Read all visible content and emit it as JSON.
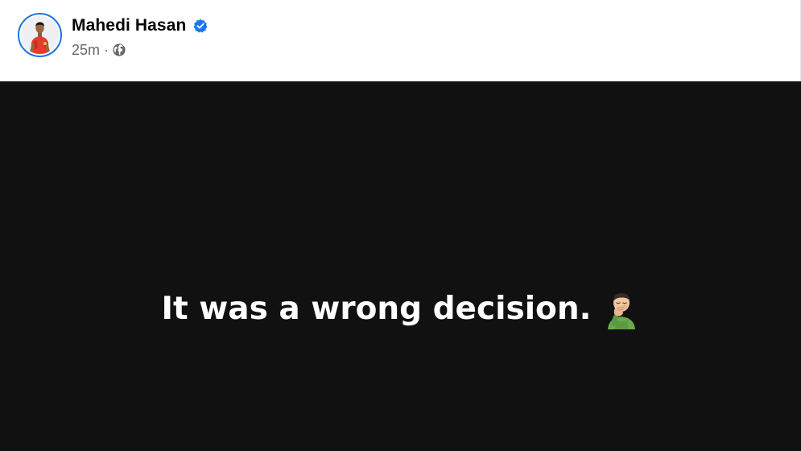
{
  "post": {
    "author_name": "Mahedi Hasan",
    "verified": true,
    "timestamp": "25m",
    "separator": "·",
    "audience_icon": "globe-icon",
    "avatar_icon": "profile-photo"
  },
  "card": {
    "text": "It was a wrong decision.",
    "emoji_icon": "face-palm-emoji",
    "background_color": "#111112",
    "text_color": "#ffffff"
  },
  "colors": {
    "verified_badge": "#1877f2",
    "avatar_ring": "#1b74e4",
    "secondary_text": "#65676b"
  }
}
